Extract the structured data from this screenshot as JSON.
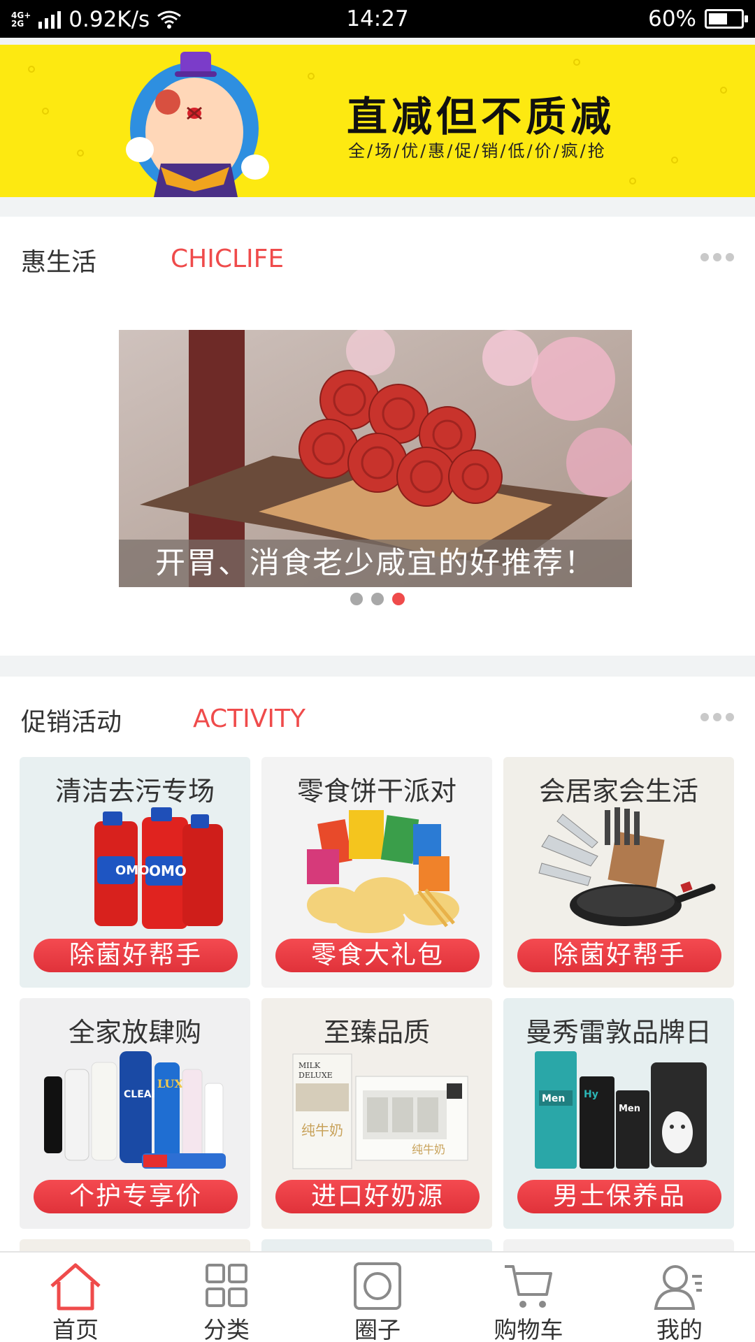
{
  "status_bar": {
    "network_type": "4G+ 2G",
    "speed": "0.92K/s",
    "time": "14:27",
    "battery_percent": "60%",
    "battery_level": 0.6
  },
  "banner": {
    "title": "直减但不质减",
    "subtitle": "全/场/优/惠/促/销/低/价/疯/抢",
    "background_color": "#fde911"
  },
  "life_section": {
    "title_cn": "惠生活",
    "title_en": "CHICLIFE",
    "carousel_caption": "开胃、消食老少咸宜的好推荐！",
    "pager_count": 3,
    "pager_active_index": 2
  },
  "activity_section": {
    "title_cn": "促销活动",
    "title_en": "ACTIVITY",
    "tiles": [
      {
        "title": "清洁去污专场",
        "tag": "除菌好帮手",
        "bg": "#e8f0f1",
        "icon": "detergent-bottles"
      },
      {
        "title": "零食饼干派对",
        "tag": "零食大礼包",
        "bg": "#f3f3f3",
        "icon": "snack-pile"
      },
      {
        "title": "会居家会生活",
        "tag": "除菌好帮手",
        "bg": "#f1efe9",
        "icon": "knife-set-and-pan"
      },
      {
        "title": "全家放肆购",
        "tag": "个护专享价",
        "bg": "#f0f0f1",
        "icon": "personal-care-bottles"
      },
      {
        "title": "至臻品质",
        "tag": "进口好奶源",
        "bg": "#f2efea",
        "icon": "milk-cartons"
      },
      {
        "title": "曼秀雷敦品牌日",
        "tag": "男士保养品",
        "bg": "#e6eff0",
        "icon": "men-skincare-set"
      }
    ]
  },
  "bottom_nav": {
    "items": [
      {
        "label": "首页",
        "icon": "home-icon",
        "active": true
      },
      {
        "label": "分类",
        "icon": "grid-icon",
        "active": false
      },
      {
        "label": "圈子",
        "icon": "circle-icon",
        "active": false
      },
      {
        "label": "购物车",
        "icon": "cart-icon",
        "active": false
      },
      {
        "label": "我的",
        "icon": "user-icon",
        "active": false
      }
    ]
  },
  "colors": {
    "accent_red": "#ef4b4b",
    "divider_gray": "#f1f3f4"
  }
}
